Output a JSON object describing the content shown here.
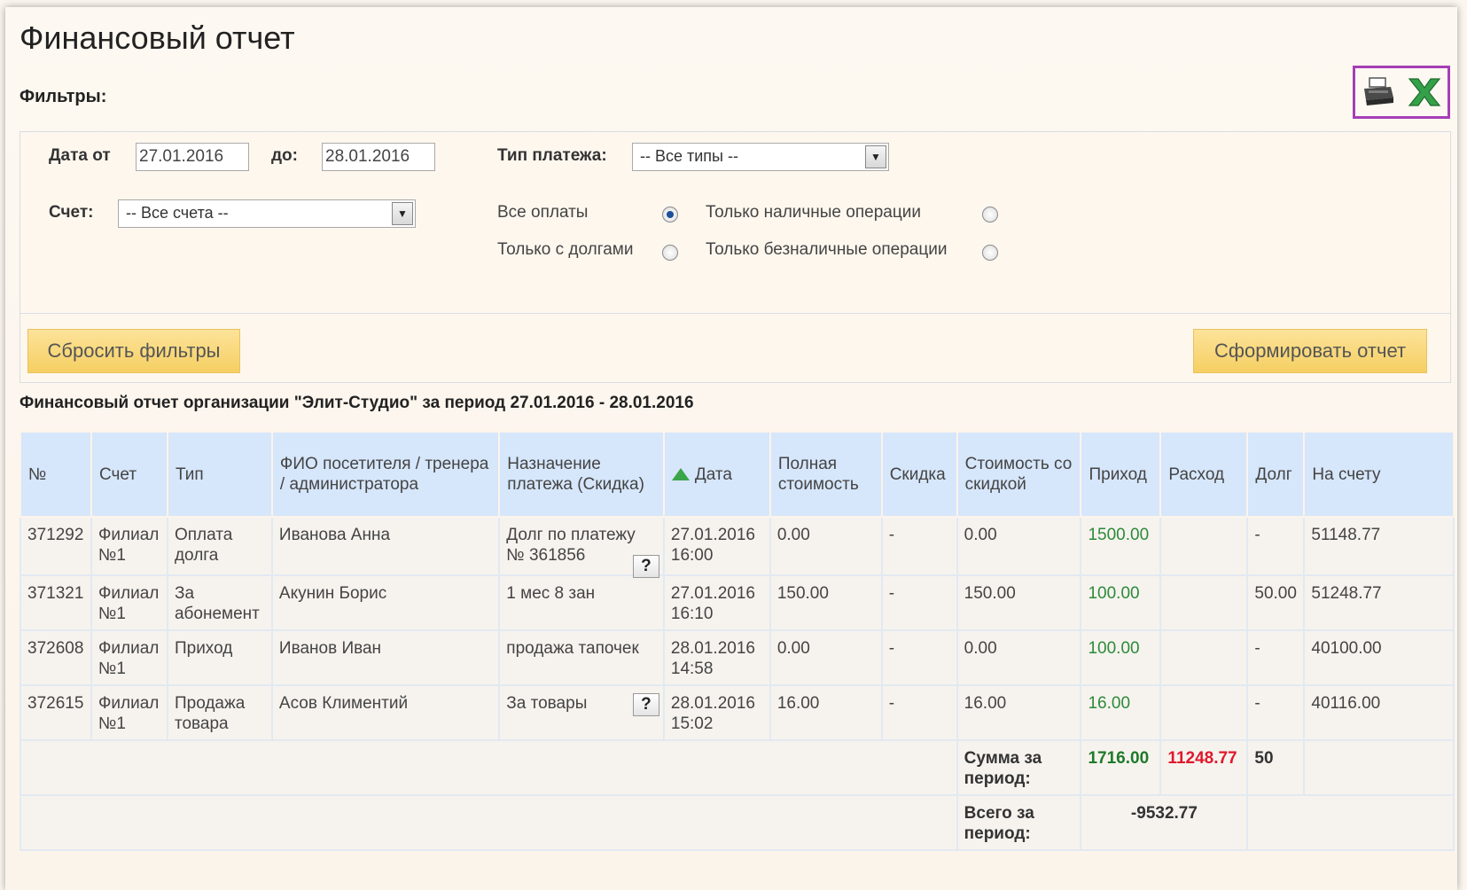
{
  "page": {
    "title": "Финансовый отчет",
    "filters_label": "Фильтры:"
  },
  "export": {
    "print_icon": "printer-icon",
    "excel_icon": "excel-icon"
  },
  "filters": {
    "date_from_label": "Дата от",
    "date_from_value": "27.01.2016",
    "date_to_label": "до:",
    "date_to_value": "28.01.2016",
    "payment_type_label": "Тип платежа:",
    "payment_type_value": "-- Все типы --",
    "account_label": "Счет:",
    "account_value": "-- Все счета --",
    "radio_all": "Все оплаты",
    "radio_debts": "Только с долгами",
    "radio_cash": "Только наличные операции",
    "radio_cashless": "Только безналичные операции",
    "reset_button": "Сбросить фильтры",
    "generate_button": "Сформировать отчет"
  },
  "report": {
    "title": "Финансовый отчет организации \"Элит-Студио\" за период 27.01.2016 - 28.01.2016",
    "columns": [
      "№",
      "Счет",
      "Тип",
      "ФИО посетителя / тренера / администратора",
      "Назначение платежа (Скидка)",
      "Дата",
      "Полная стоимость",
      "Скидка",
      "Стоимость со скидкой",
      "Приход",
      "Расход",
      "Долг",
      "На счету"
    ],
    "rows": [
      {
        "num": "371292",
        "account": "Филиал №1",
        "type": "Оплата долга",
        "person": "Иванова Анна",
        "purpose": "Долг по платежу № 361856",
        "help": "?",
        "date": "27.01.2016 16:00",
        "full": "0.00",
        "discount": "-",
        "discounted": "0.00",
        "income": "1500.00",
        "expense": "",
        "debt": "-",
        "balance": "51148.77"
      },
      {
        "num": "371321",
        "account": "Филиал №1",
        "type": "За абонемент",
        "person": "Акунин Борис",
        "purpose": "1 мес 8 зан",
        "help": "",
        "date": "27.01.2016 16:10",
        "full": "150.00",
        "discount": "-",
        "discounted": "150.00",
        "income": "100.00",
        "expense": "",
        "debt": "50.00",
        "balance": "51248.77"
      },
      {
        "num": "372608",
        "account": "Филиал №1",
        "type": "Приход",
        "person": "Иванов Иван",
        "purpose": "продажа тапочек",
        "help": "",
        "date": "28.01.2016 14:58",
        "full": "0.00",
        "discount": "-",
        "discounted": "0.00",
        "income": "100.00",
        "expense": "",
        "debt": "-",
        "balance": "40100.00"
      },
      {
        "num": "372615",
        "account": "Филиал №1",
        "type": "Продажа товара",
        "person": "Асов Климентий",
        "purpose": "За товары",
        "help": "?",
        "date": "28.01.2016 15:02",
        "full": "16.00",
        "discount": "-",
        "discounted": "16.00",
        "income": "16.00",
        "expense": "",
        "debt": "-",
        "balance": "40116.00"
      }
    ],
    "summary": {
      "period_label": "Сумма за период:",
      "income_total": "1716.00",
      "expense_total": "11248.77",
      "debt_total": "50",
      "total_label": "Всего за период:",
      "total_value": "-9532.77"
    }
  }
}
